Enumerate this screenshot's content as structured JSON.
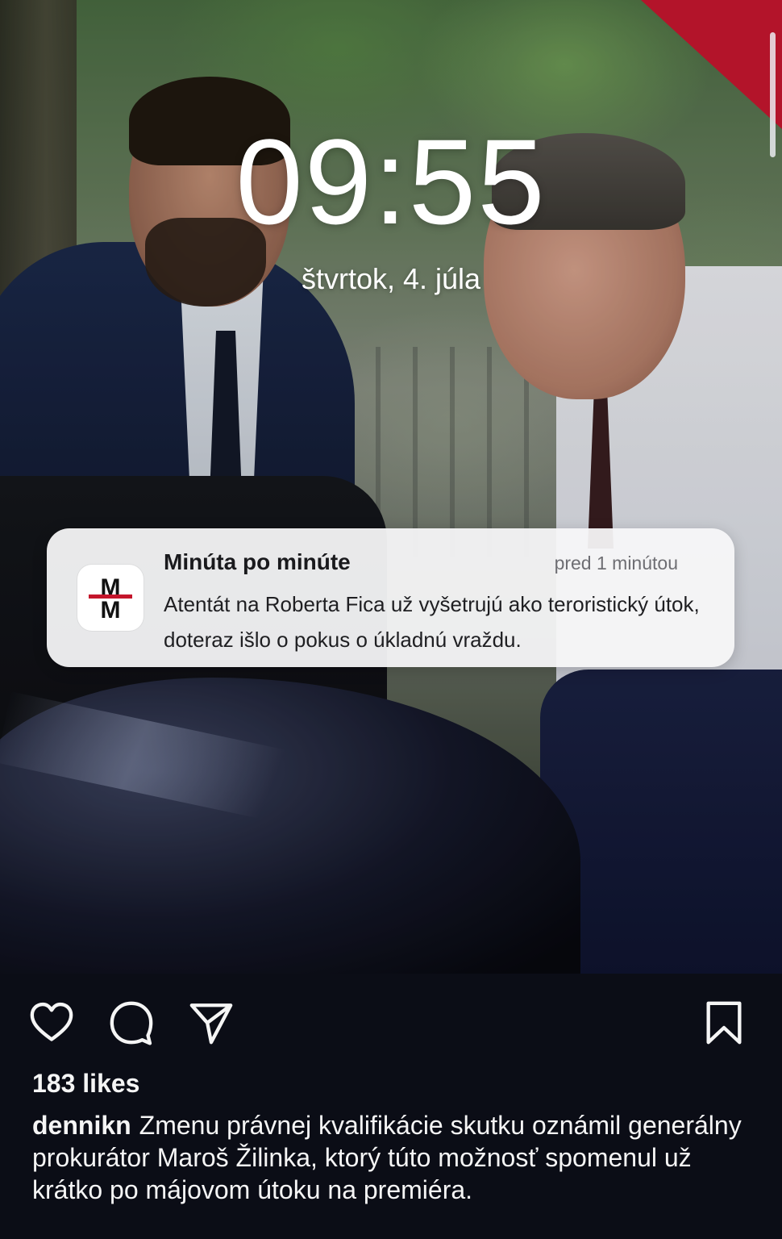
{
  "lockscreen": {
    "time": "09:55",
    "date": "štvrtok, 4. júla"
  },
  "notification": {
    "app_icon_letters": [
      "M",
      "M"
    ],
    "title": "Minúta po minúte",
    "time_ago": "pred 1 minútou",
    "body": "Atentát na Roberta Fica už vyšetrujú ako teroristický útok, doteraz išlo o pokus o úkladnú vraždu."
  },
  "colors": {
    "accent_red": "#b3142a",
    "background": "#0b0d16",
    "text": "#f5f5f5"
  },
  "post": {
    "actions": [
      {
        "icon": "heart-icon"
      },
      {
        "icon": "comment-icon"
      },
      {
        "icon": "share-icon"
      },
      {
        "icon": "bookmark-icon"
      }
    ],
    "likes": "183 likes",
    "username": "dennikn",
    "caption": "Zmenu právnej kvalifikácie skutku oznámil generálny prokurátor Maroš Žilinka, ktorý túto možnosť spomenul už krátko po májovom útoku na premiéra."
  }
}
